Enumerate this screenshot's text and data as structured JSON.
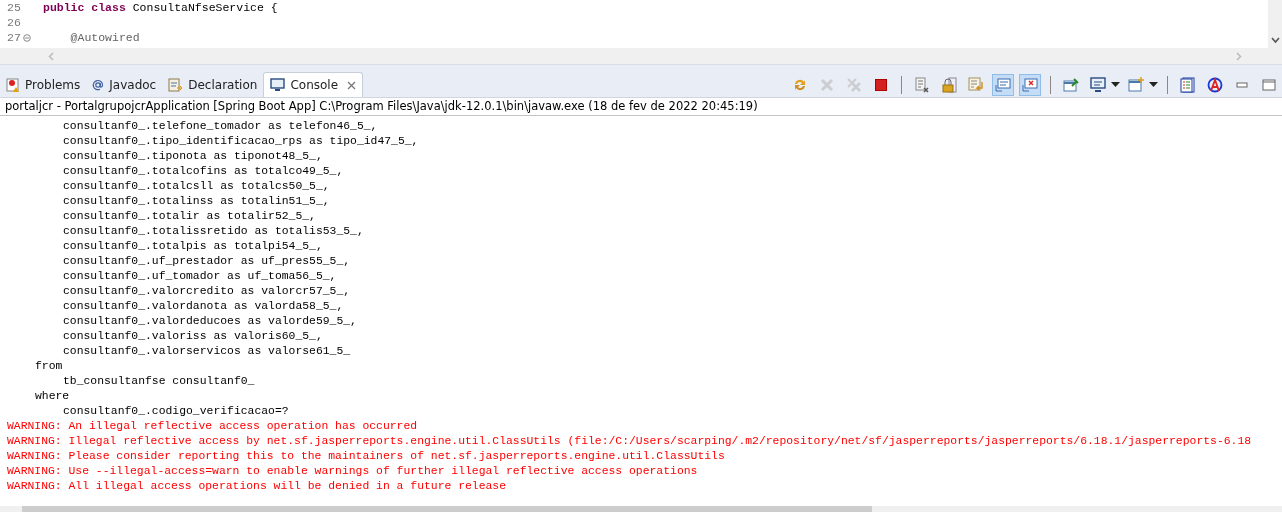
{
  "editor": {
    "lines": [
      {
        "number": "25",
        "folded": false,
        "tokens": [
          {
            "text": "public class ",
            "kind": "keyword"
          },
          {
            "text": "ConsultaNfseService {",
            "kind": "plain"
          }
        ]
      },
      {
        "number": "26",
        "folded": false
      },
      {
        "number": "27",
        "folded": true,
        "tokens": [
          {
            "text": "    @Autowired",
            "kind": "annotation"
          }
        ]
      }
    ]
  },
  "tabs": [
    {
      "label": "Problems",
      "kind": "problems",
      "selected": false
    },
    {
      "label": "Javadoc",
      "kind": "javadoc",
      "selected": false
    },
    {
      "label": "Declaration",
      "kind": "declaration",
      "selected": false
    },
    {
      "label": "Console",
      "kind": "console",
      "selected": true
    }
  ],
  "toolbar": [
    {
      "kind": "relaunch",
      "disabled": false,
      "on": false
    },
    {
      "kind": "terminate-x",
      "disabled": true,
      "on": false
    },
    {
      "kind": "remove-all",
      "disabled": true,
      "on": false
    },
    {
      "kind": "stop",
      "disabled": false,
      "on": false
    },
    {
      "kind": "sep"
    },
    {
      "kind": "clear",
      "disabled": false,
      "on": false
    },
    {
      "kind": "lock",
      "disabled": false,
      "on": false
    },
    {
      "kind": "wrap",
      "disabled": false,
      "on": false
    },
    {
      "kind": "stdout",
      "disabled": false,
      "on": true
    },
    {
      "kind": "stderr",
      "disabled": false,
      "on": true
    },
    {
      "kind": "sep"
    },
    {
      "kind": "pin",
      "disabled": false,
      "on": false
    },
    {
      "kind": "display",
      "disabled": false,
      "on": false
    },
    {
      "kind": "dropdown"
    },
    {
      "kind": "new-console",
      "disabled": false,
      "on": false
    },
    {
      "kind": "dropdown"
    },
    {
      "kind": "sep"
    },
    {
      "kind": "list",
      "disabled": false,
      "on": false
    },
    {
      "kind": "spell",
      "disabled": false,
      "on": false
    },
    {
      "kind": "minimize",
      "disabled": false,
      "on": false
    },
    {
      "kind": "maximize",
      "disabled": false,
      "on": false
    }
  ],
  "console": {
    "header": "portaljcr - PortalgrupojcrApplication [Spring Boot App] C:\\Program Files\\Java\\jdk-12.0.1\\bin\\javaw.exe (18 de fev de 2022 20:45:19)",
    "lines": [
      {
        "kind": "expr",
        "text": "consultanf0_.telefone_tomador as telefon46_5_,"
      },
      {
        "kind": "expr",
        "text": "consultanf0_.tipo_identificacao_rps as tipo_id47_5_,"
      },
      {
        "kind": "expr",
        "text": "consultanf0_.tiponota as tiponot48_5_,"
      },
      {
        "kind": "expr",
        "text": "consultanf0_.totalcofins as totalco49_5_,"
      },
      {
        "kind": "expr",
        "text": "consultanf0_.totalcsll as totalcs50_5_,"
      },
      {
        "kind": "expr",
        "text": "consultanf0_.totalinss as totalin51_5_,"
      },
      {
        "kind": "expr",
        "text": "consultanf0_.totalir as totalir52_5_,"
      },
      {
        "kind": "expr",
        "text": "consultanf0_.totalissretido as totalis53_5_,"
      },
      {
        "kind": "expr",
        "text": "consultanf0_.totalpis as totalpi54_5_,"
      },
      {
        "kind": "expr",
        "text": "consultanf0_.uf_prestador as uf_pres55_5_,"
      },
      {
        "kind": "expr",
        "text": "consultanf0_.uf_tomador as uf_toma56_5_,"
      },
      {
        "kind": "expr",
        "text": "consultanf0_.valorcredito as valorcr57_5_,"
      },
      {
        "kind": "expr",
        "text": "consultanf0_.valordanota as valorda58_5_,"
      },
      {
        "kind": "expr",
        "text": "consultanf0_.valordeducoes as valorde59_5_,"
      },
      {
        "kind": "expr",
        "text": "consultanf0_.valoriss as valoris60_5_,"
      },
      {
        "kind": "expr",
        "text": "consultanf0_.valorservicos as valorse61_5_"
      },
      {
        "kind": "keyword",
        "text": "from"
      },
      {
        "kind": "expr",
        "text": "tb_consultanfse consultanf0_"
      },
      {
        "kind": "keyword",
        "text": "where"
      },
      {
        "kind": "expr",
        "text": "consultanf0_.codigo_verificacao=?"
      },
      {
        "kind": "warning",
        "text": "WARNING: An illegal reflective access operation has occurred"
      },
      {
        "kind": "warning",
        "text": "WARNING: Illegal reflective access by net.sf.jasperreports.engine.util.ClassUtils (file:/C:/Users/scarping/.m2/repository/net/sf/jasperreports/jasperreports/6.18.1/jasperreports-6.18"
      },
      {
        "kind": "warning",
        "text": "WARNING: Please consider reporting this to the maintainers of net.sf.jasperreports.engine.util.ClassUtils"
      },
      {
        "kind": "warning",
        "text": "WARNING: Use --illegal-access=warn to enable warnings of further illegal reflective access operations"
      },
      {
        "kind": "warning",
        "text": "WARNING: All illegal access operations will be denied in a future release"
      }
    ]
  }
}
